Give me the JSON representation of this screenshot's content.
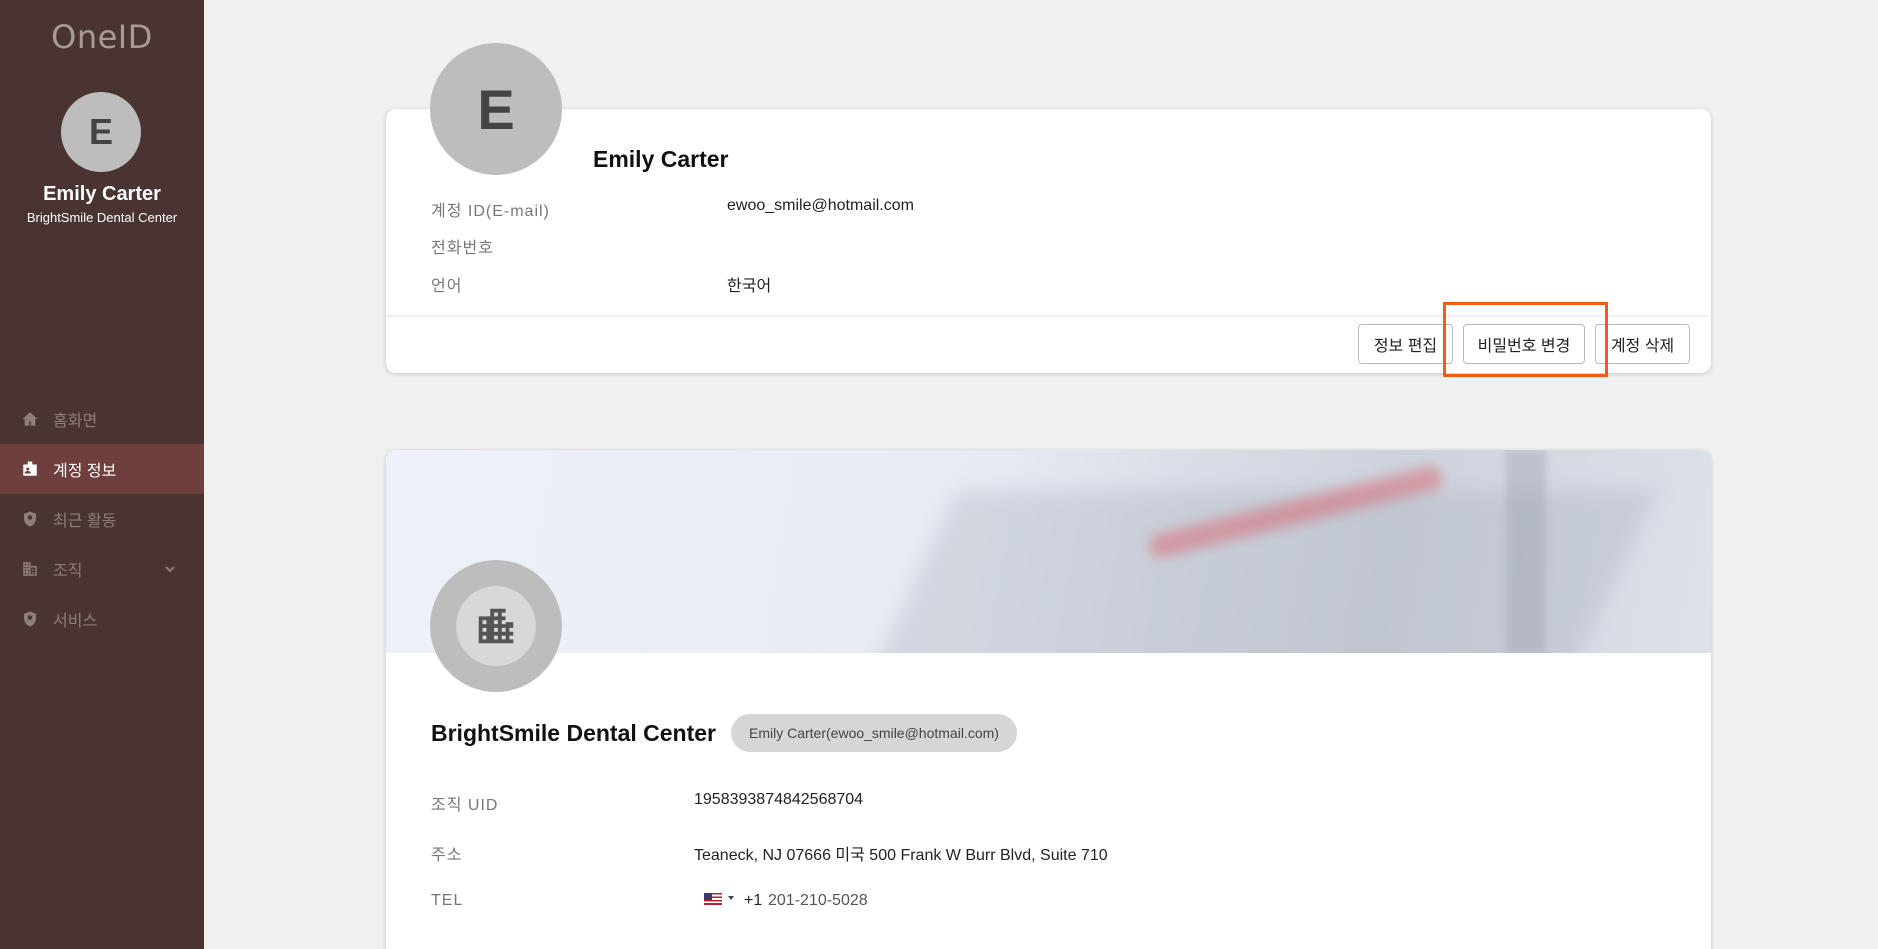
{
  "sidebar": {
    "logo": "OneID",
    "avatar_initial": "E",
    "user_name": "Emily Carter",
    "org_name": "BrightSmile Dental Center",
    "nav": [
      {
        "label": "홈화면",
        "icon": "home-icon"
      },
      {
        "label": "계정 정보",
        "icon": "id-badge-icon",
        "active": true
      },
      {
        "label": "최근 활동",
        "icon": "shield-icon"
      },
      {
        "label": "조직",
        "icon": "building-icon",
        "expandable": true
      },
      {
        "label": "서비스",
        "icon": "shield-icon"
      }
    ]
  },
  "account": {
    "avatar_initial": "E",
    "name": "Emily Carter",
    "rows": [
      {
        "label": "계정 ID(E-mail)",
        "value": "ewoo_smile@hotmail.com"
      },
      {
        "label": "전화번호",
        "value": ""
      },
      {
        "label": "언어",
        "value": "한국어"
      }
    ],
    "buttons": {
      "edit": "정보 편집",
      "change_password": "비밀번호 변경",
      "delete": "계정 삭제"
    }
  },
  "organization": {
    "name": "BrightSmile Dental Center",
    "owner_chip": "Emily Carter(ewoo_smile@hotmail.com)",
    "rows": [
      {
        "label": "조직 UID",
        "value": "1958393874842568704"
      },
      {
        "label": "주소",
        "value": "Teaneck, NJ 07666 미국 500 Frank W Burr Blvd, Suite 710"
      },
      {
        "label": "TEL",
        "code": "+1",
        "value": "201-210-5028"
      }
    ]
  },
  "colors": {
    "sidebar_bg": "#4a3432",
    "nav_active_bg": "#6e3f3c",
    "highlight": "#f25c19"
  }
}
